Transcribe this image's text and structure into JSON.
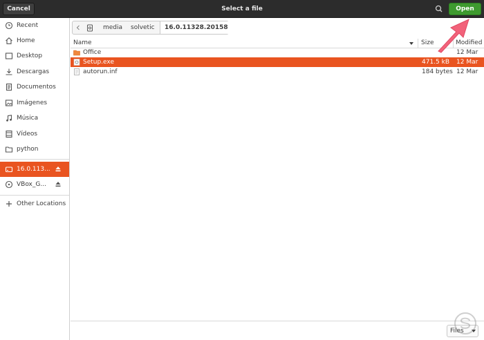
{
  "header": {
    "cancel_label": "Cancel",
    "title": "Select a file",
    "open_label": "Open",
    "accent_open": "#3e9a2f"
  },
  "sidebar": {
    "items": [
      {
        "label": "Recent",
        "icon": "clock-icon"
      },
      {
        "label": "Home",
        "icon": "home-icon"
      },
      {
        "label": "Desktop",
        "icon": "desktop-icon"
      },
      {
        "label": "Descargas",
        "icon": "download-icon"
      },
      {
        "label": "Documentos",
        "icon": "document-icon"
      },
      {
        "label": "Imágenes",
        "icon": "image-icon"
      },
      {
        "label": "Música",
        "icon": "music-icon"
      },
      {
        "label": "Vídeos",
        "icon": "video-icon"
      },
      {
        "label": "python",
        "icon": "folder-icon"
      }
    ],
    "devices": [
      {
        "label": "16.0.113...",
        "icon": "drive-icon",
        "active": true
      },
      {
        "label": "VBox_G...",
        "icon": "disc-icon",
        "active": false
      }
    ],
    "other_locations": "Other Locations",
    "accent_active": "#e95420"
  },
  "pathbar": {
    "segments": [
      "media",
      "solvetic",
      "16.0.11328.20158"
    ]
  },
  "list": {
    "columns": {
      "name": "Name",
      "size": "Size",
      "modified": "Modified"
    },
    "rows": [
      {
        "name": "Office",
        "size": "",
        "modified": "12 Mar",
        "icon": "folder-icon",
        "selected": false
      },
      {
        "name": "Setup.exe",
        "size": "471.5 kB",
        "modified": "12 Mar",
        "icon": "executable-icon",
        "selected": true
      },
      {
        "name": "autorun.inf",
        "size": "184 bytes",
        "modified": "12 Mar",
        "icon": "text-file-icon",
        "selected": false
      }
    ]
  },
  "filter": {
    "label": "Files"
  }
}
